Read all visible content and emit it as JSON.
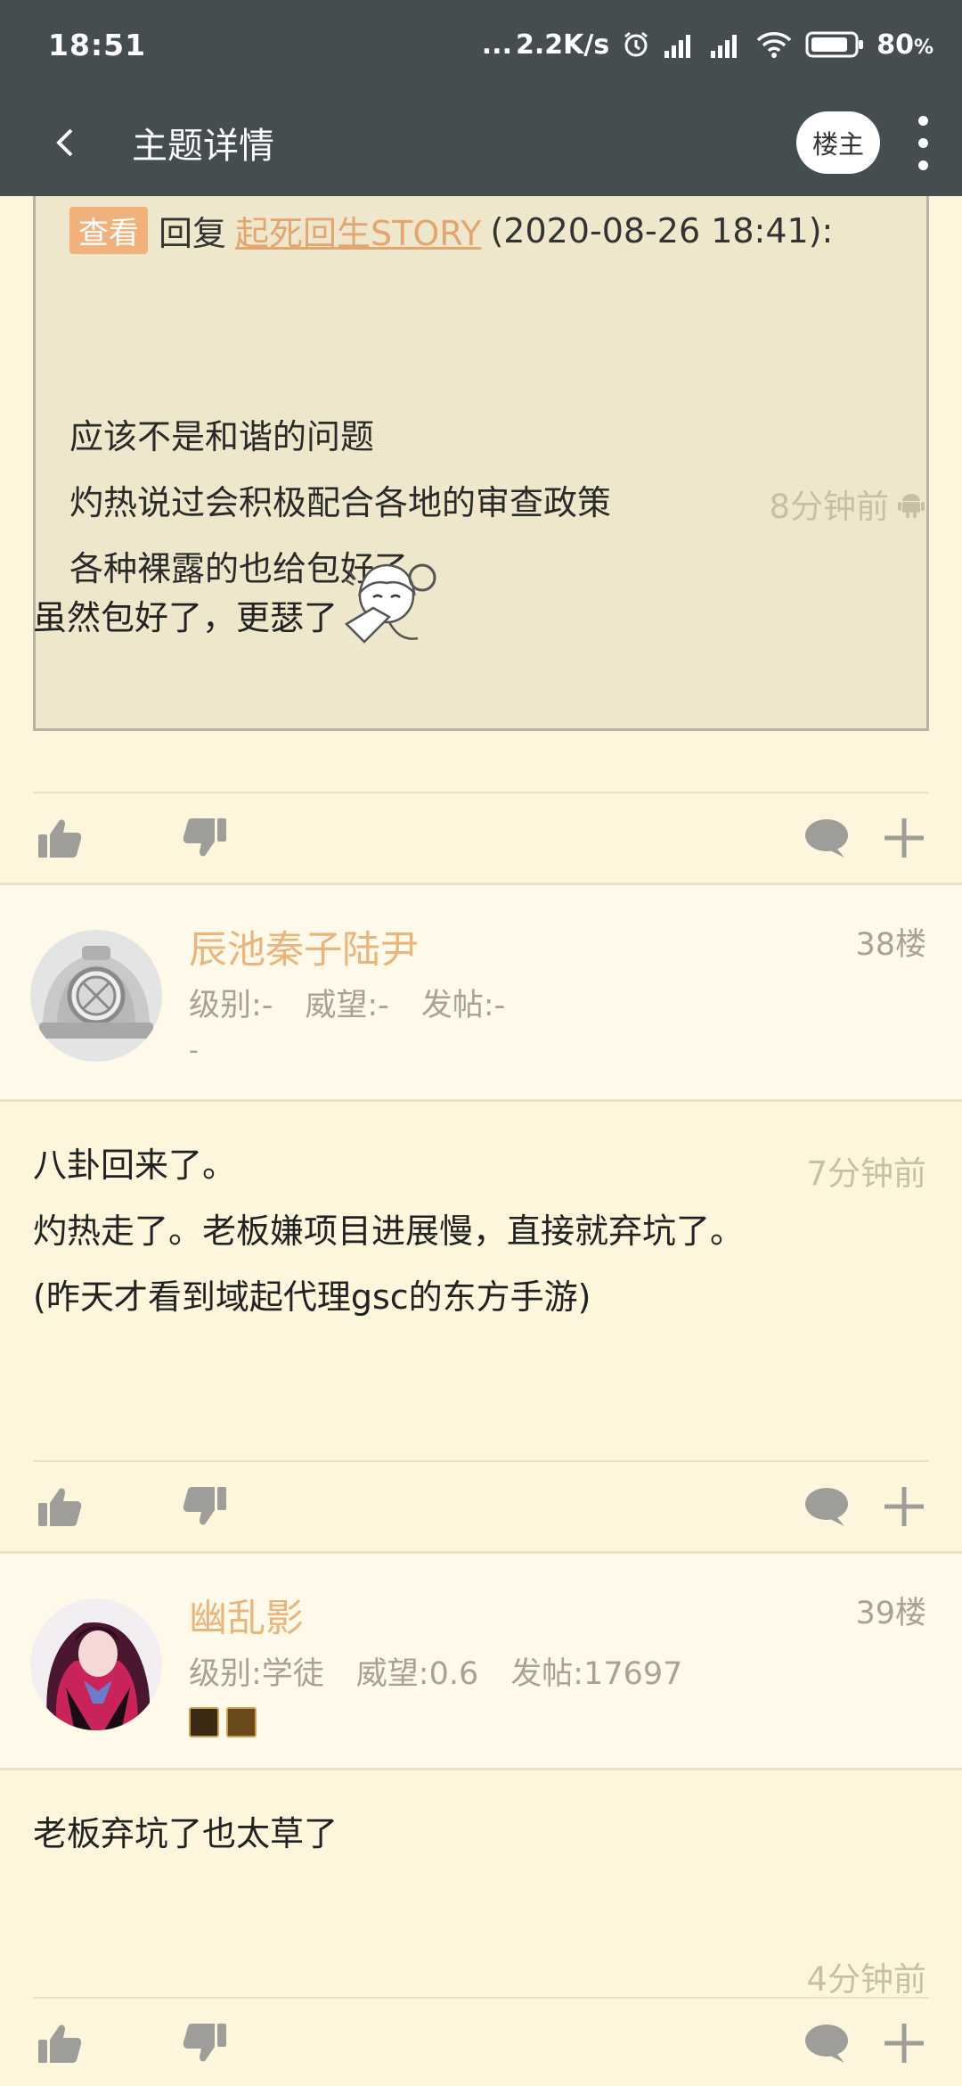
{
  "status_bar": {
    "time": "18:51",
    "dots": "...",
    "net_speed": "2.2K/s",
    "battery": "80",
    "battery_unit": "%"
  },
  "app_bar": {
    "title": "主题详情",
    "op_button": "楼主"
  },
  "quote": {
    "view_tag": "查看",
    "reply_word": "回复",
    "reply_user": "起死回生STORY",
    "reply_time": "(2020-08-26 18:41):",
    "lines": [
      "应该不是和谐的问题",
      "灼热说过会积极配合各地的审查政策",
      "各种裸露的也给包好了"
    ]
  },
  "post37": {
    "text": "虽然包好了，更瑟了",
    "time": "8分钟前",
    "device_icon": "android-icon"
  },
  "post38": {
    "username": "辰池秦子陆尹",
    "floor": "38楼",
    "level": "级别:-",
    "prestige": "威望:-",
    "posts": "发帖:-",
    "extra": "-",
    "lines": [
      "八卦回来了。",
      "灼热走了。老板嫌项目进展慢，直接就弃坑了。",
      "(昨天才看到域起代理gsc的东方手游)"
    ],
    "time": "7分钟前"
  },
  "post39": {
    "username": "幽乱影",
    "floor": "39楼",
    "level": "级别:学徒",
    "prestige": "威望:0.6",
    "posts": "发帖:17697",
    "text": "老板弃坑了也太草了",
    "time": "4分钟前"
  },
  "colors": {
    "bar": "#454d50",
    "background": "#fdf6dd",
    "username": "#e8b57c",
    "muted": "#a9a293"
  }
}
